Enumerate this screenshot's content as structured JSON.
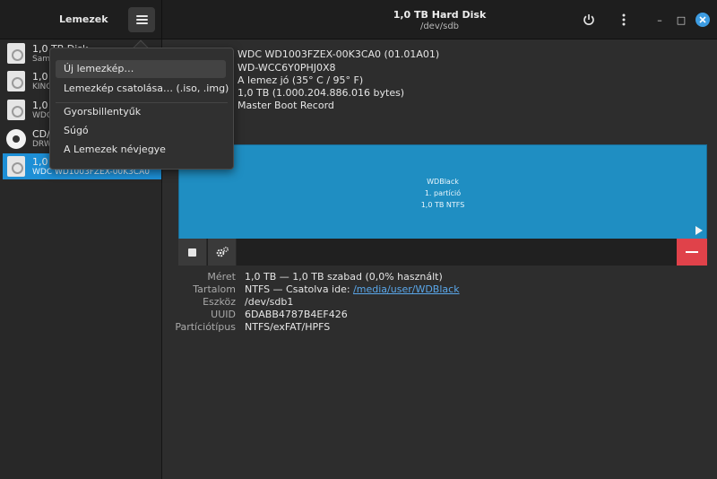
{
  "header": {
    "app_title": "Lemezek",
    "window_title": "1,0 TB Hard Disk",
    "window_subtitle": "/dev/sdb",
    "minimize_label": "–",
    "maximize_label": "□"
  },
  "sidebar": {
    "devices": [
      {
        "name": "1,0 TB Disk",
        "sub": "Sam",
        "icon": "hard-disk-icon",
        "selected": false
      },
      {
        "name": "1,0",
        "sub": "KING",
        "icon": "hard-disk-icon",
        "selected": false
      },
      {
        "name": "1,0",
        "sub": "WDC",
        "icon": "hard-disk-icon",
        "selected": false
      },
      {
        "name": "CD/",
        "sub": "DRW",
        "icon": "optical-disc-icon",
        "selected": false
      },
      {
        "name": "1,0",
        "sub": "WDC WD1003FZEX-00K3CA0",
        "icon": "hard-disk-icon",
        "selected": true
      }
    ]
  },
  "menu": {
    "items": [
      {
        "label": "Új lemezkép…"
      },
      {
        "label": "Lemezkép csatolása… (.iso, .img)"
      },
      {
        "label": "Gyorsbillentyűk"
      },
      {
        "label": "Súgó"
      },
      {
        "label": "A Lemezek névjegye"
      }
    ]
  },
  "drive_info": {
    "model": "WDC WD1003FZEX-00K3CA0 (01.01A01)",
    "serial": "WD-WCC6Y0PHJ0X8",
    "assessment": "A lemez jó (35° C / 95° F)",
    "size": "1,0 TB (1.000.204.886.016 bytes)",
    "partitioning": "Master Boot Record"
  },
  "volume": {
    "name": "WDBlack",
    "partition": "1. partíció",
    "fs": "1,0 TB NTFS",
    "color": "#1f8ec2"
  },
  "details": {
    "size_label": "Méret",
    "size_value": "1,0 TB — 1,0 TB szabad (0,0% használt)",
    "content_label": "Tartalom",
    "content_prefix": "NTFS — Csatolva ide:",
    "content_link": "/media/user/WDBlack",
    "device_label": "Eszköz",
    "device_value": "/dev/sdb1",
    "uuid_label": "UUID",
    "uuid_value": "6DABB4787B4EF426",
    "ptype_label": "Partíciótípus",
    "ptype_value": "NTFS/exFAT/HPFS"
  },
  "colors": {
    "accent": "#1d8fd6",
    "delete": "#e0424a",
    "close": "#3d9ce2"
  }
}
